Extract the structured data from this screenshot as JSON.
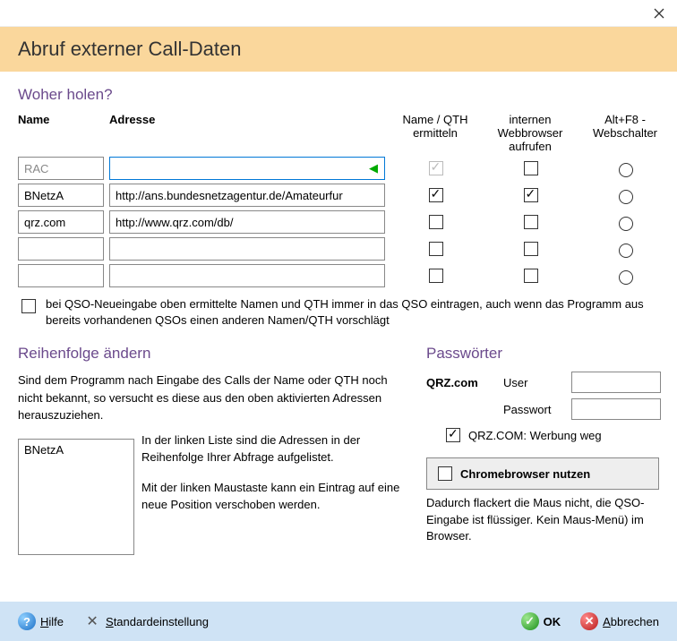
{
  "window": {
    "title": "Abruf externer Call-Daten"
  },
  "section1": {
    "title": "Woher holen?"
  },
  "headers": {
    "name": "Name",
    "addr": "Adresse",
    "col1": "Name / QTH ermitteln",
    "col2": "internen Webbrowser aufrufen",
    "col3": "Alt+F8 - Webschalter"
  },
  "rows": [
    {
      "name": "RAC",
      "addr": "",
      "locked": true,
      "c1": true,
      "c2": false
    },
    {
      "name": "BNetzA",
      "addr": "http://ans.bundesnetzagentur.de/Amateurfur",
      "locked": false,
      "c1": true,
      "c2": true
    },
    {
      "name": "qrz.com",
      "addr": "http://www.qrz.com/db/",
      "locked": false,
      "c1": false,
      "c2": false
    },
    {
      "name": "",
      "addr": "",
      "locked": false,
      "c1": false,
      "c2": false
    },
    {
      "name": "",
      "addr": "",
      "locked": false,
      "c1": false,
      "c2": false
    }
  ],
  "opt": {
    "text": "bei QSO-Neueingabe oben ermittelte Namen und QTH immer in das QSO eintragen, auch wenn das Programm aus bereits vorhandenen QSOs einen anderen Namen/QTH vorschlägt"
  },
  "section2": {
    "title": "Reihenfolge ändern"
  },
  "reorder": {
    "desc": "Sind dem Programm nach Eingabe des Calls der Name oder QTH noch nicht bekannt, so versucht es diese aus den oben aktivierten Adressen  herauszuziehen.",
    "list": [
      "BNetzA"
    ],
    "right1": "In der linken Liste sind die Adressen in der Reihenfolge Ihrer Abfrage aufgelistet.",
    "right2": "Mit der linken Maustaste  kann ein Eintrag auf eine neue Position verschoben werden."
  },
  "section3": {
    "title": "Passwörter"
  },
  "pw": {
    "site": "QRZ.com",
    "userLabel": "User",
    "passLabel": "Passwort",
    "user": "",
    "pass": "",
    "adblockLabel": "QRZ.COM: Werbung weg",
    "adblock": true
  },
  "chrome": {
    "label": "Chromebrowser nutzen",
    "checked": false,
    "desc": "Dadurch flackert die Maus nicht, die QSO-Eingabe ist flüssiger. Kein  Maus-Menü) im Browser."
  },
  "footer": {
    "help": "Hilfe",
    "defaults": "Standardeinstellung",
    "ok": "OK",
    "cancel": "Abbrechen"
  }
}
